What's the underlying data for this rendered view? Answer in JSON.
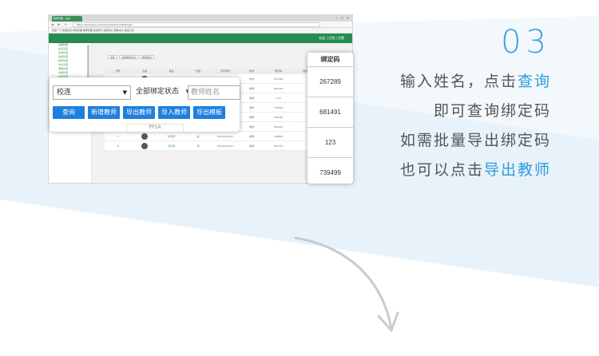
{
  "colors": {
    "accent": "#2e9bdc",
    "button_blue": "#1f7fde",
    "header_green": "#258c4f",
    "band": "#eaf3fb"
  },
  "browser": {
    "tab_title": "教师管理 - 后台",
    "url": "https://example.com/admin/teacher/list#/login",
    "bookmarks": "百度一下  新闻资讯  学校管理  教师管理  在线学习  资源中心  帮助中心  常用工具"
  },
  "app_header": {
    "user": "欢迎 | 注销 | 设置"
  },
  "sidebar": {
    "items": [
      "基础管理",
      "校区设置",
      "年级管理",
      "班级管理",
      "教师管理",
      "学生管理",
      "课程管理",
      "考勤管理",
      "成绩管理",
      "家长管理",
      "通知管理",
      "作业管理",
      "资源管理"
    ]
  },
  "mini_filter": [
    "校区",
    "全部绑定状态",
    "教师姓名"
  ],
  "mini_table": {
    "headers": [
      "序号",
      "头像",
      "姓名",
      "性别",
      "手机号码",
      "职务",
      "绑定码",
      "操作"
    ],
    "rows": [
      {
        "no": "1",
        "name": "王老师",
        "sex": "女",
        "phone": "1381234xxxx",
        "duty": "校长",
        "code": "267289"
      },
      {
        "no": "2",
        "name": "李老师",
        "sex": "男",
        "phone": "1391234xxxx",
        "duty": "教师",
        "code": "681491"
      },
      {
        "no": "3",
        "name": "张老师",
        "sex": "女",
        "phone": "1371234xxxx",
        "duty": "教师",
        "code": "123"
      },
      {
        "no": "4",
        "name": "赵老师",
        "sex": "男",
        "phone": "1361234xxxx",
        "duty": "教务",
        "code": "739499"
      },
      {
        "no": "5",
        "name": "陈老师",
        "sex": "女",
        "phone": "1351234xxxx",
        "duty": "教师",
        "code": "381245"
      },
      {
        "no": "6",
        "name": "刘老师",
        "sex": "男",
        "phone": "1331234xxxx",
        "duty": "教务",
        "code": "562013"
      },
      {
        "no": "7",
        "name": "杨老师",
        "sex": "女",
        "phone": "1321234xxxx",
        "duty": "教师",
        "code": "148870"
      },
      {
        "no": "8",
        "name": "周老师",
        "sex": "男",
        "phone": "1301234xxxx",
        "duty": "教师",
        "code": "907733"
      }
    ]
  },
  "filter_popup": {
    "campus_select": "校连",
    "bind_status_select": "全部绑定状态",
    "name_placeholder": "教师姓名",
    "buttons": [
      "查询",
      "新增教师",
      "导出教师",
      "导入教师",
      "导出模板"
    ],
    "stub_label": "PP1A"
  },
  "code_popup": {
    "header": "绑定码",
    "codes": [
      "267289",
      "681491",
      "123",
      "739499"
    ]
  },
  "instructions": {
    "step": "03",
    "line1_prefix": "输入姓名，点击",
    "line1_highlight": "查询",
    "line2": "即可查询绑定码",
    "line3": "如需批量导出绑定码",
    "line4_prefix": "也可以点击",
    "line4_highlight": "导出教师"
  }
}
